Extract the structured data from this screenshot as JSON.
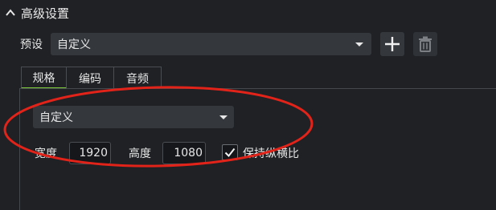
{
  "section": {
    "title": "高级设置",
    "icon": "chevron-up-icon"
  },
  "preset": {
    "label": "预设",
    "selected": "自定义",
    "add_icon": "plus-icon",
    "delete_icon": "trash-icon"
  },
  "tabs": [
    {
      "label": "规格",
      "active": true
    },
    {
      "label": "编码",
      "active": false
    },
    {
      "label": "音频",
      "active": false
    }
  ],
  "resolution": {
    "selected": "自定义"
  },
  "dimensions": {
    "width_label": "宽度",
    "width_value": "1920",
    "height_label": "高度",
    "height_value": "1080",
    "keep_aspect_label": "保持纵横比",
    "keep_aspect_checked": true
  },
  "colors": {
    "background": "#1f2124",
    "control": "#34383d",
    "tab_active_underline": "#7ecb3b",
    "annotation": "#e2231a"
  }
}
